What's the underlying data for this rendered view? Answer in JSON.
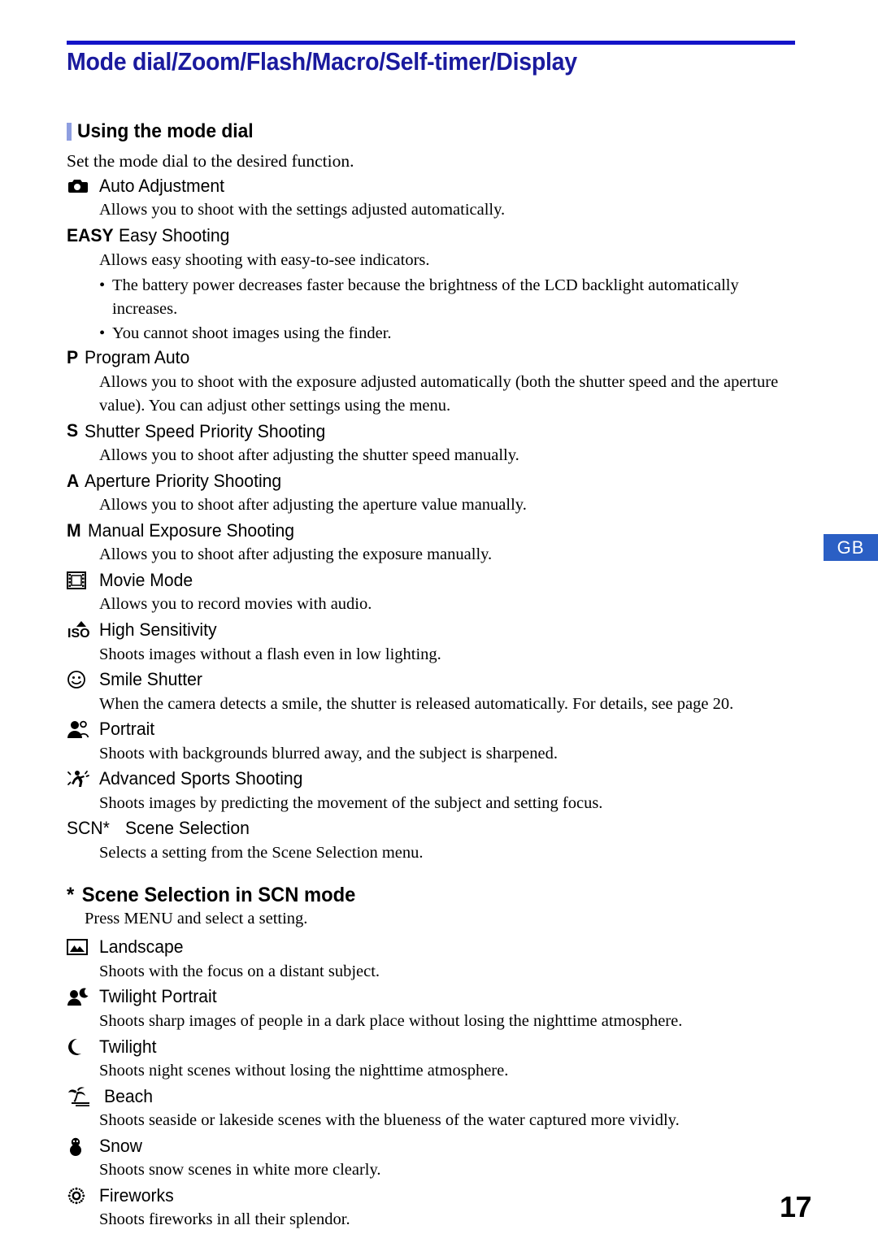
{
  "page": {
    "title": "Mode dial/Zoom/Flash/Macro/Self-timer/Display",
    "number": "17",
    "side_tab": "GB",
    "accent_rule_color": "#1414c8",
    "title_color": "#1a1a9e",
    "tick_color": "#8e9ee0",
    "badge_color": "#2b5fc4"
  },
  "section": {
    "heading": "Using the mode dial",
    "intro": "Set the mode dial to the desired function.",
    "modes": [
      {
        "icon": "camera-icon",
        "icon_type": "shape",
        "label": "Auto Adjustment",
        "desc": "Allows you to shoot with the settings adjusted automatically.",
        "bullets": []
      },
      {
        "icon": "easy-text-icon",
        "icon_type": "text",
        "icon_text": "EASY",
        "label": "Easy Shooting",
        "desc": "Allows easy shooting with easy-to-see indicators.",
        "bullets": [
          "The battery power decreases faster because the brightness of the LCD backlight automatically increases.",
          "You cannot shoot images using the finder."
        ]
      },
      {
        "icon": "program-auto-text-icon",
        "icon_type": "text",
        "icon_text": "P",
        "label": "Program Auto",
        "desc": "Allows you to shoot with the exposure adjusted automatically (both the shutter speed and the aperture value). You can adjust other settings using the menu.",
        "bullets": []
      },
      {
        "icon": "shutter-priority-text-icon",
        "icon_type": "text",
        "icon_text": "S",
        "label": "Shutter Speed Priority Shooting",
        "desc": "Allows you to shoot after adjusting the shutter speed manually.",
        "bullets": []
      },
      {
        "icon": "aperture-priority-text-icon",
        "icon_type": "text",
        "icon_text": "A",
        "label": "Aperture Priority Shooting",
        "desc": "Allows you to shoot after adjusting the aperture value manually.",
        "bullets": []
      },
      {
        "icon": "manual-exposure-text-icon",
        "icon_type": "text",
        "icon_text": "M",
        "label": "Manual Exposure Shooting",
        "desc": "Allows you to shoot after adjusting the exposure manually.",
        "bullets": []
      },
      {
        "icon": "film-strip-icon",
        "icon_type": "shape",
        "label": "Movie Mode",
        "desc": "Allows you to record movies with audio.",
        "bullets": []
      },
      {
        "icon": "iso-high-sensitivity-icon",
        "icon_type": "shape",
        "label": "High Sensitivity",
        "desc": "Shoots images without a flash even in low lighting.",
        "bullets": []
      },
      {
        "icon": "smiley-face-icon",
        "icon_type": "shape",
        "label": "Smile Shutter",
        "desc": "When the camera detects a smile, the shutter is released automatically. For details, see page 20.",
        "bullets": []
      },
      {
        "icon": "portrait-people-icon",
        "icon_type": "shape",
        "label": "Portrait",
        "desc": "Shoots with backgrounds blurred away, and the subject is sharpened.",
        "bullets": []
      },
      {
        "icon": "running-person-icon",
        "icon_type": "shape",
        "label": "Advanced Sports Shooting",
        "desc": "Shoots images by predicting the movement of the subject and setting focus.",
        "bullets": []
      },
      {
        "icon": "scn-text-icon",
        "icon_type": "text",
        "icon_text": "SCN*",
        "label": "Scene Selection",
        "desc": "Selects a setting from the Scene Selection menu.",
        "bullets": []
      }
    ]
  },
  "subsection": {
    "star": "*",
    "heading": "Scene Selection in SCN mode",
    "intro": "Press MENU and select a setting.",
    "modes": [
      {
        "icon": "landscape-mountain-icon",
        "label": "Landscape",
        "desc": "Shoots with the focus on a distant subject."
      },
      {
        "icon": "twilight-portrait-icon",
        "label": "Twilight Portrait",
        "desc": "Shoots sharp images of people in a dark place without losing the nighttime atmosphere."
      },
      {
        "icon": "crescent-moon-icon",
        "label": "Twilight",
        "desc": "Shoots night scenes without losing the nighttime atmosphere."
      },
      {
        "icon": "palm-tree-beach-icon",
        "label": "Beach",
        "desc": "Shoots seaside or lakeside scenes with the blueness of the water captured more vividly."
      },
      {
        "icon": "snowman-icon",
        "label": "Snow",
        "desc": "Shoots snow scenes in white more clearly."
      },
      {
        "icon": "fireworks-burst-icon",
        "label": "Fireworks",
        "desc": "Shoots fireworks in all their splendor."
      }
    ]
  }
}
